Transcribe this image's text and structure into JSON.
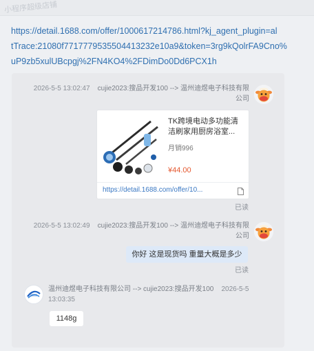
{
  "watermark": "小程序超级店铺",
  "link": {
    "line1": "https://detail.1688.com/offer/1000617214786.html?kj_agent_plugin=al",
    "line2": "tTrace:21080f7717779535504413232e10a9&token=3rg9kQolrFA9Cno%",
    "line3": "uP9zb5xulUBcpgj%2FN4KO4%2FDimDo0Dd6PCX1h"
  },
  "messages": [
    {
      "datetime": "2026-5-5 13:02:47",
      "sender": "cujie2023:搜品开发100 --> 温州迪煜电子科技有限",
      "sender_line2": "公司",
      "card": {
        "title": "TK跨境电动多功能清洁刷家用厨房浴室...",
        "sales": "月销996",
        "price": "¥44.00",
        "url": "https://detail.1688.com/offer/10..."
      },
      "status": "已读"
    },
    {
      "datetime": "2026-5-5 13:02:49",
      "sender": "cujie2023:搜品开发100 --> 温州迪煜电子科技有限",
      "sender_line2": "公司",
      "text": "你好 这是现货吗 重量大概是多少",
      "status": "已读"
    },
    {
      "sender": "温州迪煜电子科技有限公司 --> cujie2023:搜品开发100",
      "datetime_part1": "2026-5-5",
      "datetime_part2": "13:03:35",
      "text": "1148g"
    }
  ],
  "icons": {
    "user_avatar": "ox-cartoon-avatar-icon",
    "shop_logo": "diyu-logo-icon",
    "document": "document-icon"
  },
  "colors": {
    "link": "#2f6fb0",
    "price": "#e4572e",
    "bubble_self": "#dde9f8"
  }
}
